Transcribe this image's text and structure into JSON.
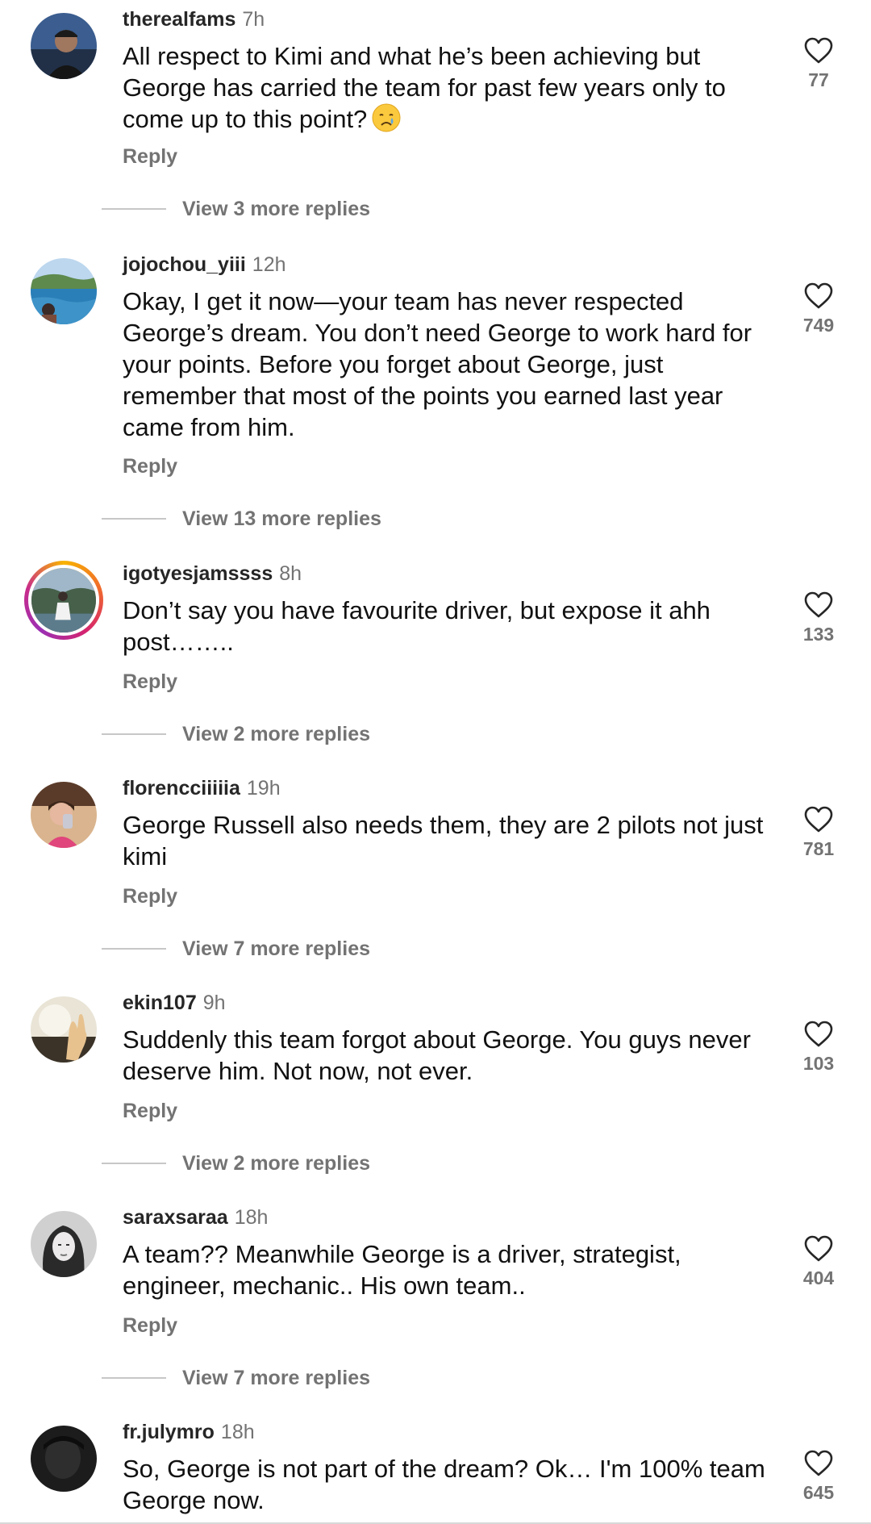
{
  "comments": [
    {
      "username": "therealfams",
      "time": "7h",
      "text": "All respect to Kimi and what he’s been achieving but George has carried the team for past few years only to come up to this point?",
      "emoji": "crying-face-icon",
      "reply_label": "Reply",
      "view_more": "View 3 more replies",
      "likes": "77"
    },
    {
      "username": "jojochou_yiii",
      "time": "12h",
      "text": "Okay, I get it now—your team has never respected George’s dream. You don’t need George to work hard for your points. Before you forget about George, just remember that most of the points you earned last year came from him.",
      "reply_label": "Reply",
      "view_more": "View 13 more replies",
      "likes": "749"
    },
    {
      "username": "igotyesjamssss",
      "time": "8h",
      "text": "Don’t say you have favourite driver, but expose it ahh post……..",
      "reply_label": "Reply",
      "view_more": "View 2 more replies",
      "likes": "133"
    },
    {
      "username": "florencciiiiia",
      "time": "19h",
      "text": "George Russell also needs them, they are 2 pilots not just kimi",
      "reply_label": "Reply",
      "view_more": "View 7 more replies",
      "likes": "781"
    },
    {
      "username": "ekin107",
      "time": "9h",
      "text": "Suddenly this team forgot about George. You guys never deserve him. Not now, not ever.",
      "reply_label": "Reply",
      "view_more": "View 2 more replies",
      "likes": "103"
    },
    {
      "username": "saraxsaraa",
      "time": "18h",
      "text": "A team?? Meanwhile George is a driver, strategist, engineer, mechanic.. His own team..",
      "reply_label": "Reply",
      "view_more": "View 7 more replies",
      "likes": "404"
    },
    {
      "username": "fr.julymro",
      "time": "18h",
      "text": "So, George is not part of the dream? Ok… I'm 100% team George now.",
      "likes": "645"
    }
  ],
  "colors": {
    "text": "#111111",
    "muted": "#737373",
    "username": "#262626",
    "divider": "#c7c7c7"
  }
}
